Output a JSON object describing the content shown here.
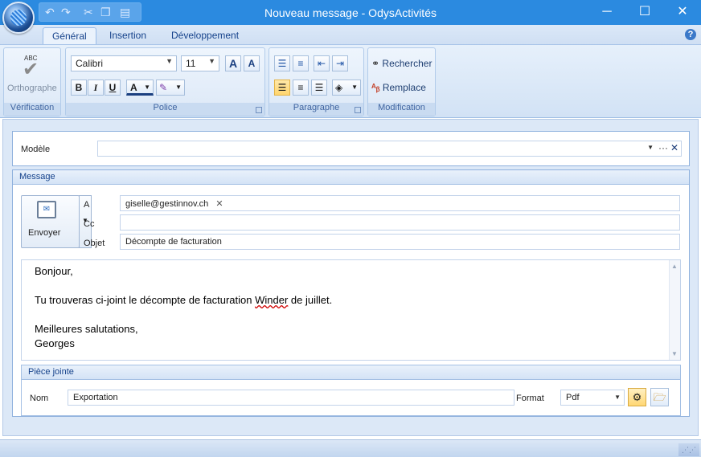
{
  "window": {
    "title": "Nouveau message - OdysActivités"
  },
  "tabs": [
    {
      "label": "Général",
      "active": true
    },
    {
      "label": "Insertion"
    },
    {
      "label": "Développement"
    }
  ],
  "ribbon": {
    "verification": {
      "group_label": "Vérification",
      "spell_button": "Orthographe",
      "abc": "ABC"
    },
    "police": {
      "group_label": "Police",
      "font_family": "Calibri",
      "font_size": "11",
      "grow_icon": "A",
      "shrink_icon": "A",
      "bold": "B",
      "italic": "I",
      "underline": "U",
      "color_icon": "A"
    },
    "paragraphe": {
      "group_label": "Paragraphe"
    },
    "modification": {
      "group_label": "Modification",
      "find": "Rechercher",
      "replace": "Remplace"
    }
  },
  "modele": {
    "label": "Modèle",
    "value": "",
    "more": "···",
    "clear": "✕"
  },
  "message": {
    "header": "Message",
    "send_button": "Envoyer",
    "to_label": "A",
    "to_recipient": "giselle@gestinnov.ch",
    "cc_label": "Cc",
    "cc_value": "",
    "subject_label": "Objet",
    "subject_value": "Décompte de facturation",
    "body": {
      "line1": "Bonjour,",
      "line2_pre": "Tu trouveras ci-joint le décompte de facturation ",
      "line2_word": "Winder",
      "line2_post": " de juillet.",
      "line3": "Meilleures salutations,",
      "line4": "Georges"
    }
  },
  "attachment": {
    "header": "Pièce jointe",
    "name_label": "Nom",
    "name_value": "Exportation",
    "format_label": "Format",
    "format_value": "Pdf"
  }
}
